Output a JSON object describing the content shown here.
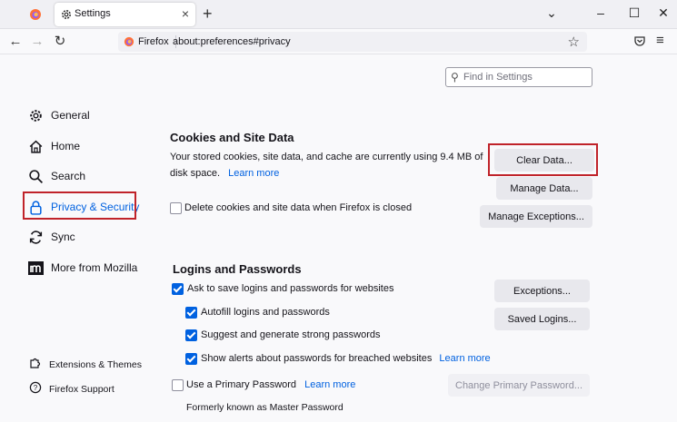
{
  "tabs": [
    {
      "title": "Settings",
      "icon": "gear-icon"
    }
  ],
  "url": {
    "identity": "Firefox",
    "address": "about:preferences#privacy"
  },
  "search": {
    "placeholder": "Find in Settings"
  },
  "sidebar": {
    "items": [
      {
        "label": "General",
        "icon": "gear-icon"
      },
      {
        "label": "Home",
        "icon": "home-icon"
      },
      {
        "label": "Search",
        "icon": "search-icon"
      },
      {
        "label": "Privacy & Security",
        "icon": "lock-icon",
        "selected": true
      },
      {
        "label": "Sync",
        "icon": "sync-icon"
      },
      {
        "label": "More from Mozilla",
        "icon": "mozilla-icon"
      }
    ],
    "footer": [
      {
        "label": "Extensions & Themes",
        "icon": "puzzle-icon"
      },
      {
        "label": "Firefox Support",
        "icon": "help-icon"
      }
    ]
  },
  "cookies": {
    "title": "Cookies and Site Data",
    "desc_line1": "Your stored cookies, site data, and cache are currently using 9.4 MB of",
    "desc_line2": "disk space.",
    "learn_more": "Learn more",
    "clear_data": "Clear Data...",
    "manage_data": "Manage Data...",
    "manage_exceptions": "Manage Exceptions...",
    "delete_on_close": {
      "label": "Delete cookies and site data when Firefox is closed",
      "checked": false
    }
  },
  "logins": {
    "title": "Logins and Passwords",
    "ask_to_save": {
      "label": "Ask to save logins and passwords for websites",
      "checked": true
    },
    "autofill": {
      "label": "Autofill logins and passwords",
      "checked": true
    },
    "suggest": {
      "label": "Suggest and generate strong passwords",
      "checked": true
    },
    "breach_alerts": {
      "label": "Show alerts about passwords for breached websites",
      "checked": true
    },
    "breach_learn_more": "Learn more",
    "primary_password": {
      "label": "Use a Primary Password",
      "checked": false
    },
    "primary_learn_more": "Learn more",
    "formerly": "Formerly known as Master Password",
    "exceptions": "Exceptions...",
    "saved_logins": "Saved Logins...",
    "change_primary": "Change Primary Password..."
  },
  "colors": {
    "accent": "#0061e0",
    "highlight": "#c0232a"
  }
}
